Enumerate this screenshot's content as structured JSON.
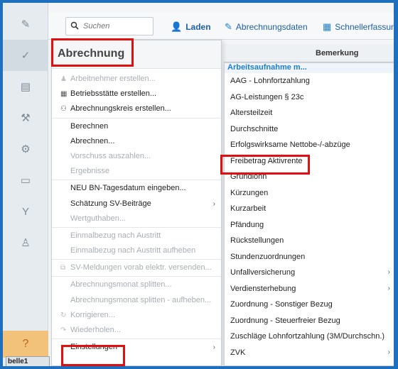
{
  "toolbar": {
    "search_placeholder": "Suchen",
    "buttons": [
      {
        "label": "Laden",
        "icon": "person-icon"
      },
      {
        "label": "Abrechnungsdaten",
        "icon": "pencil-icon"
      },
      {
        "label": "Schnellerfassung",
        "icon": "grid-icon"
      }
    ]
  },
  "column_header": "Bemerkung",
  "menu": {
    "title": "Abrechnung",
    "items": [
      {
        "label": "Arbeitnehmer erstellen...",
        "disabled": true,
        "icon": "person-icon"
      },
      {
        "label": "Betriebsstätte erstellen...",
        "disabled": false,
        "icon": "building-icon"
      },
      {
        "label": "Abrechnungskreis erstellen...",
        "disabled": false,
        "icon": "group-icon"
      },
      {
        "label": "Berechnen",
        "disabled": false
      },
      {
        "label": "Abrechnen...",
        "disabled": false
      },
      {
        "label": "Vorschuss auszahlen...",
        "disabled": true
      },
      {
        "label": "Ergebnisse",
        "disabled": true
      },
      {
        "label": "NEU BN-Tagesdatum eingeben...",
        "disabled": false
      },
      {
        "label": "Schätzung SV-Beiträge",
        "disabled": false,
        "submenu": true
      },
      {
        "label": "Wertguthaben...",
        "disabled": true
      },
      {
        "label": "Einmalbezug nach Austritt",
        "disabled": true
      },
      {
        "label": "Einmalbezug nach Austritt aufheben",
        "disabled": true
      },
      {
        "label": "SV-Meldungen vorab elektr. versenden...",
        "disabled": true,
        "icon": "send-icon"
      },
      {
        "label": "Abrechnungsmonat splitten...",
        "disabled": true
      },
      {
        "label": "Abrechnungsmonat splitten - aufheben...",
        "disabled": true
      },
      {
        "label": "Korrigieren...",
        "disabled": true,
        "icon": "refresh-icon"
      },
      {
        "label": "Wiederholen...",
        "disabled": true,
        "icon": "redo-icon"
      },
      {
        "label": "Einstellungen",
        "disabled": false,
        "submenu": true
      }
    ]
  },
  "submenu": {
    "header": "Arbeitsaufnahme m...",
    "items": [
      {
        "label": "AAG - Lohnfortzahlung",
        "submenu": false
      },
      {
        "label": "AG-Leistungen § 23c",
        "submenu": false
      },
      {
        "label": "Altersteilzeit",
        "submenu": false
      },
      {
        "label": "Durchschnitte",
        "submenu": false
      },
      {
        "label": "Erfolgswirksame Nettobe-/-abzüge",
        "submenu": false
      },
      {
        "label": "Freibetrag Aktivrente",
        "submenu": false
      },
      {
        "label": "Grundlohn",
        "submenu": false
      },
      {
        "label": "Kürzungen",
        "submenu": false
      },
      {
        "label": "Kurzarbeit",
        "submenu": false
      },
      {
        "label": "Pfändung",
        "submenu": false
      },
      {
        "label": "Rückstellungen",
        "submenu": false
      },
      {
        "label": "Stundenzuordnungen",
        "submenu": false
      },
      {
        "label": "Unfallversicherung",
        "submenu": true
      },
      {
        "label": "Verdiensterhebung",
        "submenu": true
      },
      {
        "label": "Zuordnung - Sonstiger Bezug",
        "submenu": false
      },
      {
        "label": "Zuordnung - Steuerfreier Bezug",
        "submenu": false
      },
      {
        "label": "Zuschläge Lohnfortzahlung (3M/Durchschn.)",
        "submenu": false
      },
      {
        "label": "ZVK",
        "submenu": true
      }
    ]
  },
  "sheet_tab": "belle1",
  "colors": {
    "frame": "#1f6fbf",
    "highlight": "#e01010",
    "accent": "#1e7ec6",
    "help": "#f2c27a"
  }
}
